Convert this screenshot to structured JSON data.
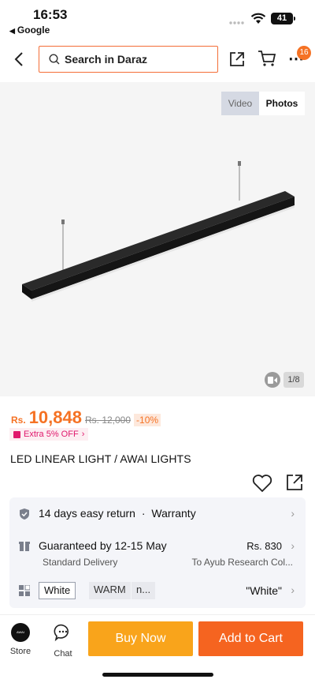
{
  "status_bar": {
    "time": "16:53",
    "back_app": "Google",
    "battery": "41"
  },
  "header": {
    "search_placeholder": "Search in Daraz",
    "cart_badge": "16"
  },
  "gallery": {
    "video_label": "Video",
    "photos_label": "Photos",
    "counter": "1/8"
  },
  "price": {
    "currency": "Rs.",
    "current": "10,848",
    "original": "Rs. 12,000",
    "discount": "-10%",
    "extra_offer": "Extra 5% OFF"
  },
  "product": {
    "title": "LED LINEAR LIGHT / AWAI LIGHTS"
  },
  "services": {
    "return_label": "14 days easy return",
    "separator": "·",
    "warranty_label": "Warranty",
    "delivery_label": "Guaranteed by 12-15 May",
    "delivery_type": "Standard Delivery",
    "delivery_price": "Rs. 830",
    "delivery_to": "To Ayub Research Col...",
    "variants": [
      "White",
      "WARM",
      "n..."
    ],
    "selected_variant": "\"White\""
  },
  "bottom_bar": {
    "store_label": "Store",
    "chat_label": "Chat",
    "buy_now": "Buy Now",
    "add_to_cart": "Add to Cart"
  },
  "colors": {
    "accent": "#f57224",
    "buy_now": "#f9a41b",
    "add_to_cart": "#f56420",
    "promo": "#e0186c"
  }
}
